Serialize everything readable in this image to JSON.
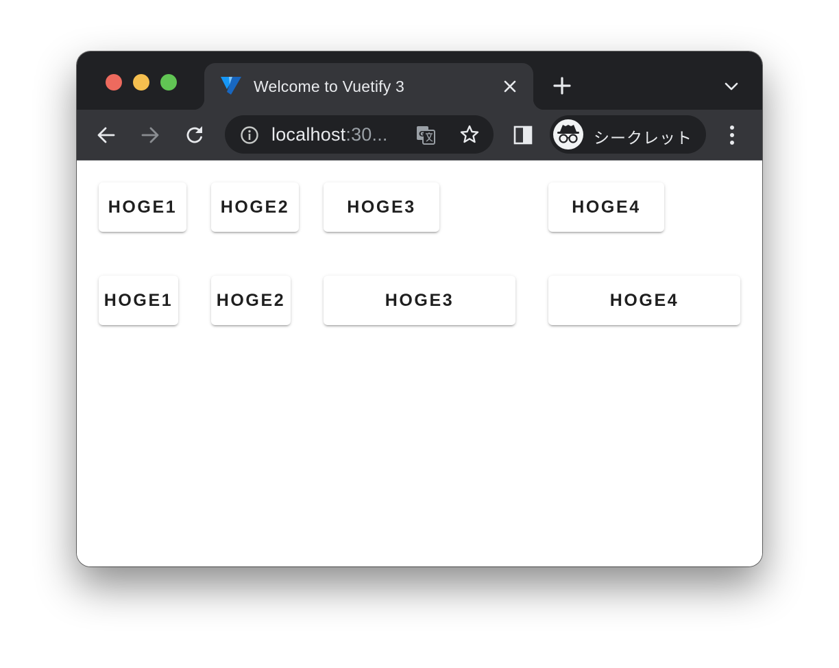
{
  "browser": {
    "tab": {
      "title": "Welcome to Vuetify 3"
    },
    "address_bar": {
      "host": "localhost",
      "rest": ":30..."
    },
    "profile": {
      "label": "シークレット"
    }
  },
  "page": {
    "row1": [
      "HOGE1",
      "HOGE2",
      "HOGE3",
      "HOGE4"
    ],
    "row2": [
      "HOGE1",
      "HOGE2",
      "HOGE3",
      "HOGE4"
    ]
  },
  "colors": {
    "tab_strip": "#202124",
    "toolbar": "#35363a",
    "traffic_close": "#ed6a5e",
    "traffic_minimize": "#f5bf4f",
    "traffic_maximize": "#61c554",
    "vuetify_light": "#1697f6",
    "vuetify_dark": "#1867c0"
  },
  "icons": [
    "vuetify-logo-icon",
    "close-icon",
    "plus-icon",
    "chevron-down-icon",
    "back-arrow-icon",
    "forward-arrow-icon",
    "reload-icon",
    "info-icon",
    "translate-icon",
    "star-icon",
    "side-panel-icon",
    "incognito-icon",
    "more-vert-icon"
  ]
}
